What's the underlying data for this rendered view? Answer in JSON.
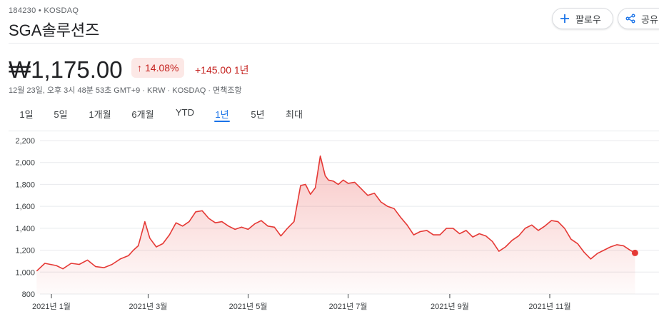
{
  "header": {
    "ticker": "184230 • KOSDAQ",
    "company_name": "SGA솔루션즈",
    "follow_label": "팔로우",
    "share_label": "공유"
  },
  "quote": {
    "price": "₩1,175.00",
    "percent_change": "14.08%",
    "abs_change": "+145.00 1년",
    "meta": "12월 23일, 오후 3시 48분 53초 GMT+9 · KRW · KOSDAQ · 면책조항"
  },
  "tabs": [
    {
      "label": "1일",
      "active": false
    },
    {
      "label": "5일",
      "active": false
    },
    {
      "label": "1개월",
      "active": false
    },
    {
      "label": "6개월",
      "active": false
    },
    {
      "label": "YTD",
      "active": false
    },
    {
      "label": "1년",
      "active": true
    },
    {
      "label": "5년",
      "active": false
    },
    {
      "label": "최대",
      "active": false
    }
  ],
  "colors": {
    "accent": "#1a73e8",
    "negative_line": "#e53935",
    "change_text": "#c5221f",
    "change_bg": "#fce8e6"
  },
  "icons": {
    "follow": "plus-icon",
    "share": "share-icon",
    "change": "arrow-up-icon"
  },
  "chart_data": {
    "type": "area",
    "ylim": [
      800,
      2200
    ],
    "yticks": [
      800,
      1000,
      1200,
      1400,
      1600,
      1800,
      2000,
      2200
    ],
    "ytick_labels": [
      "800",
      "1,000",
      "1,200",
      "1,400",
      "1,600",
      "1,800",
      "2,000",
      "2,200"
    ],
    "xticks": [
      {
        "date": "2021-01-01",
        "label": "2021년 1월"
      },
      {
        "date": "2021-03-01",
        "label": "2021년 3월"
      },
      {
        "date": "2021-05-01",
        "label": "2021년 5월"
      },
      {
        "date": "2021-07-01",
        "label": "2021년 7월"
      },
      {
        "date": "2021-09-01",
        "label": "2021년 9월"
      },
      {
        "date": "2021-11-01",
        "label": "2021년 11월"
      }
    ],
    "grid": true,
    "legend": "none",
    "series": [
      {
        "x": [
          "2020-12-23",
          "2020-12-28",
          "2021-01-04",
          "2021-01-08",
          "2021-01-13",
          "2021-01-18",
          "2021-01-23",
          "2021-01-28",
          "2021-02-02",
          "2021-02-07",
          "2021-02-12",
          "2021-02-17",
          "2021-02-20",
          "2021-02-23",
          "2021-02-27",
          "2021-03-02",
          "2021-03-06",
          "2021-03-10",
          "2021-03-14",
          "2021-03-18",
          "2021-03-22",
          "2021-03-26",
          "2021-03-30",
          "2021-04-03",
          "2021-04-07",
          "2021-04-11",
          "2021-04-15",
          "2021-04-19",
          "2021-04-23",
          "2021-04-27",
          "2021-05-01",
          "2021-05-05",
          "2021-05-09",
          "2021-05-13",
          "2021-05-17",
          "2021-05-21",
          "2021-05-25",
          "2021-05-29",
          "2021-06-02",
          "2021-06-05",
          "2021-06-08",
          "2021-06-11",
          "2021-06-14",
          "2021-06-17",
          "2021-06-19",
          "2021-06-22",
          "2021-06-25",
          "2021-06-28",
          "2021-07-01",
          "2021-07-05",
          "2021-07-09",
          "2021-07-13",
          "2021-07-17",
          "2021-07-21",
          "2021-07-25",
          "2021-07-29",
          "2021-08-02",
          "2021-08-06",
          "2021-08-10",
          "2021-08-14",
          "2021-08-18",
          "2021-08-22",
          "2021-08-26",
          "2021-08-30",
          "2021-09-03",
          "2021-09-07",
          "2021-09-11",
          "2021-09-15",
          "2021-09-19",
          "2021-09-23",
          "2021-09-27",
          "2021-10-01",
          "2021-10-05",
          "2021-10-09",
          "2021-10-13",
          "2021-10-17",
          "2021-10-21",
          "2021-10-25",
          "2021-10-29",
          "2021-11-02",
          "2021-11-06",
          "2021-11-10",
          "2021-11-14",
          "2021-11-18",
          "2021-11-22",
          "2021-11-26",
          "2021-11-30",
          "2021-12-04",
          "2021-12-08",
          "2021-12-12",
          "2021-12-16",
          "2021-12-20",
          "2021-12-23"
        ],
        "values": [
          1010,
          1080,
          1060,
          1030,
          1080,
          1070,
          1110,
          1050,
          1040,
          1070,
          1120,
          1150,
          1200,
          1240,
          1460,
          1310,
          1230,
          1260,
          1340,
          1450,
          1420,
          1460,
          1550,
          1560,
          1490,
          1450,
          1460,
          1420,
          1390,
          1410,
          1390,
          1440,
          1470,
          1420,
          1410,
          1330,
          1400,
          1460,
          1790,
          1800,
          1710,
          1770,
          2060,
          1880,
          1840,
          1830,
          1800,
          1840,
          1810,
          1820,
          1760,
          1700,
          1720,
          1640,
          1600,
          1580,
          1500,
          1430,
          1340,
          1370,
          1380,
          1340,
          1340,
          1400,
          1400,
          1350,
          1380,
          1320,
          1350,
          1330,
          1280,
          1190,
          1230,
          1290,
          1330,
          1400,
          1430,
          1380,
          1420,
          1470,
          1460,
          1400,
          1300,
          1260,
          1180,
          1120,
          1170,
          1200,
          1230,
          1250,
          1240,
          1200,
          1175
        ]
      }
    ]
  }
}
